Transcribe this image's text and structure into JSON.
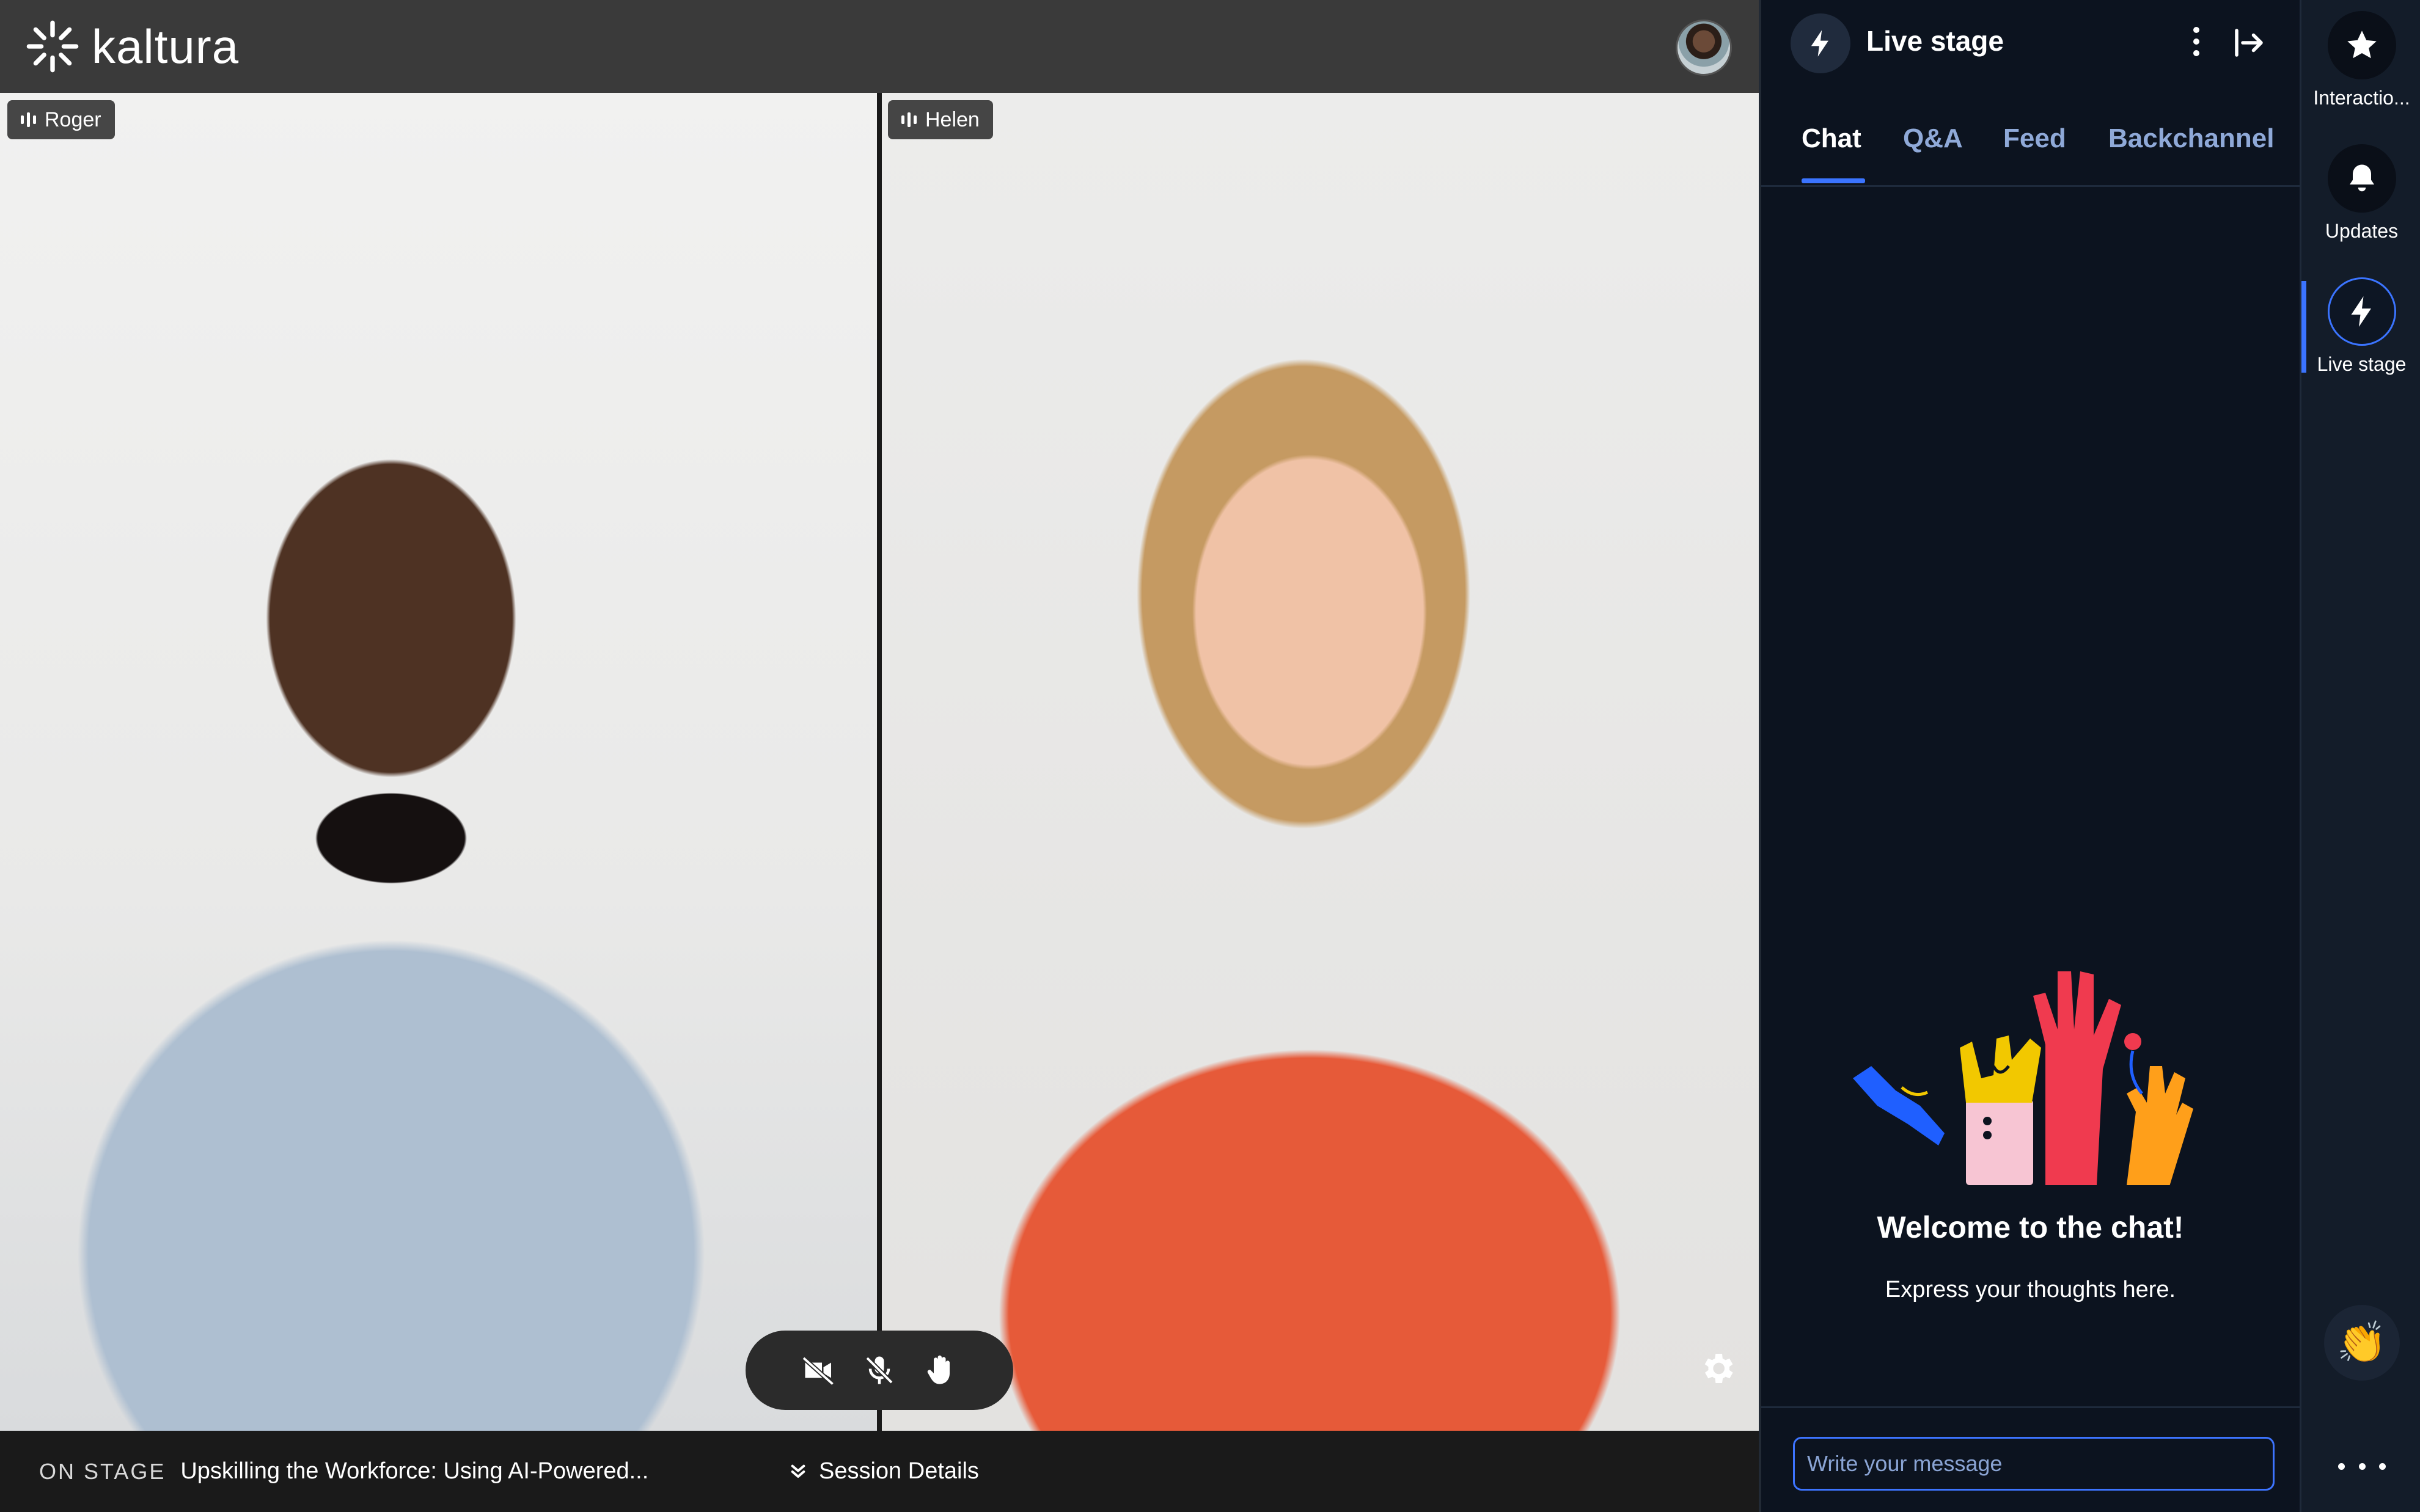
{
  "app": {
    "brand": "kaltura"
  },
  "participants": [
    {
      "name": "Roger"
    },
    {
      "name": "Helen"
    }
  ],
  "bottom_bar": {
    "on_stage_label": "ON STAGE",
    "session_title": "Upskilling the Workforce: Using AI-Powered...",
    "session_details_label": "Session Details"
  },
  "controls": {
    "camera": "video-off-icon",
    "mic": "mic-off-icon",
    "raise_hand": "hand-icon",
    "settings": "gear-icon"
  },
  "panel": {
    "title": "Live stage",
    "tabs": [
      {
        "label": "Chat",
        "active": true
      },
      {
        "label": "Q&A",
        "active": false
      },
      {
        "label": "Feed",
        "active": false
      },
      {
        "label": "Backchannel",
        "active": false
      }
    ],
    "welcome_title": "Welcome to the chat!",
    "welcome_subtitle": "Express your thoughts here.",
    "composer_placeholder": "Write your message"
  },
  "rail": {
    "items": [
      {
        "label": "Interactio...",
        "icon": "star-icon"
      },
      {
        "label": "Updates",
        "icon": "bell-icon"
      },
      {
        "label": "Live stage",
        "icon": "lightning-icon",
        "active": true
      }
    ],
    "reaction_icon": "clapping-hands-icon",
    "more_icon": "more-icon"
  },
  "colors": {
    "accent": "#3b74ff",
    "panel_bg": "#0c131f",
    "tab_inactive": "#8fa9d8"
  }
}
